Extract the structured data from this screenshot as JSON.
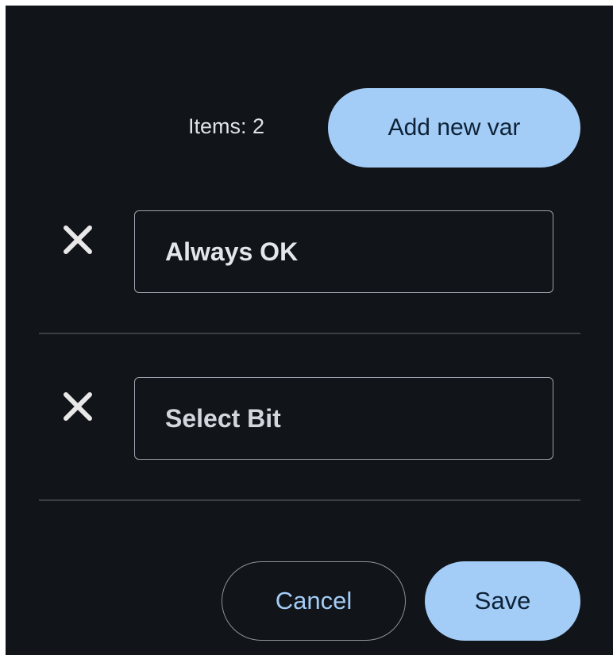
{
  "header": {
    "items_count_label": "Items: 2",
    "add_button_label": "Add new var"
  },
  "variables": [
    {
      "value": "Always OK",
      "remove_icon": "close-icon"
    },
    {
      "value": "Select Bit",
      "remove_icon": "close-icon"
    }
  ],
  "footer": {
    "cancel_label": "Cancel",
    "save_label": "Save"
  },
  "colors": {
    "background": "#111418",
    "accent": "#a3ccf7",
    "text": "#e3e6eb",
    "divider": "#3a3e45"
  }
}
